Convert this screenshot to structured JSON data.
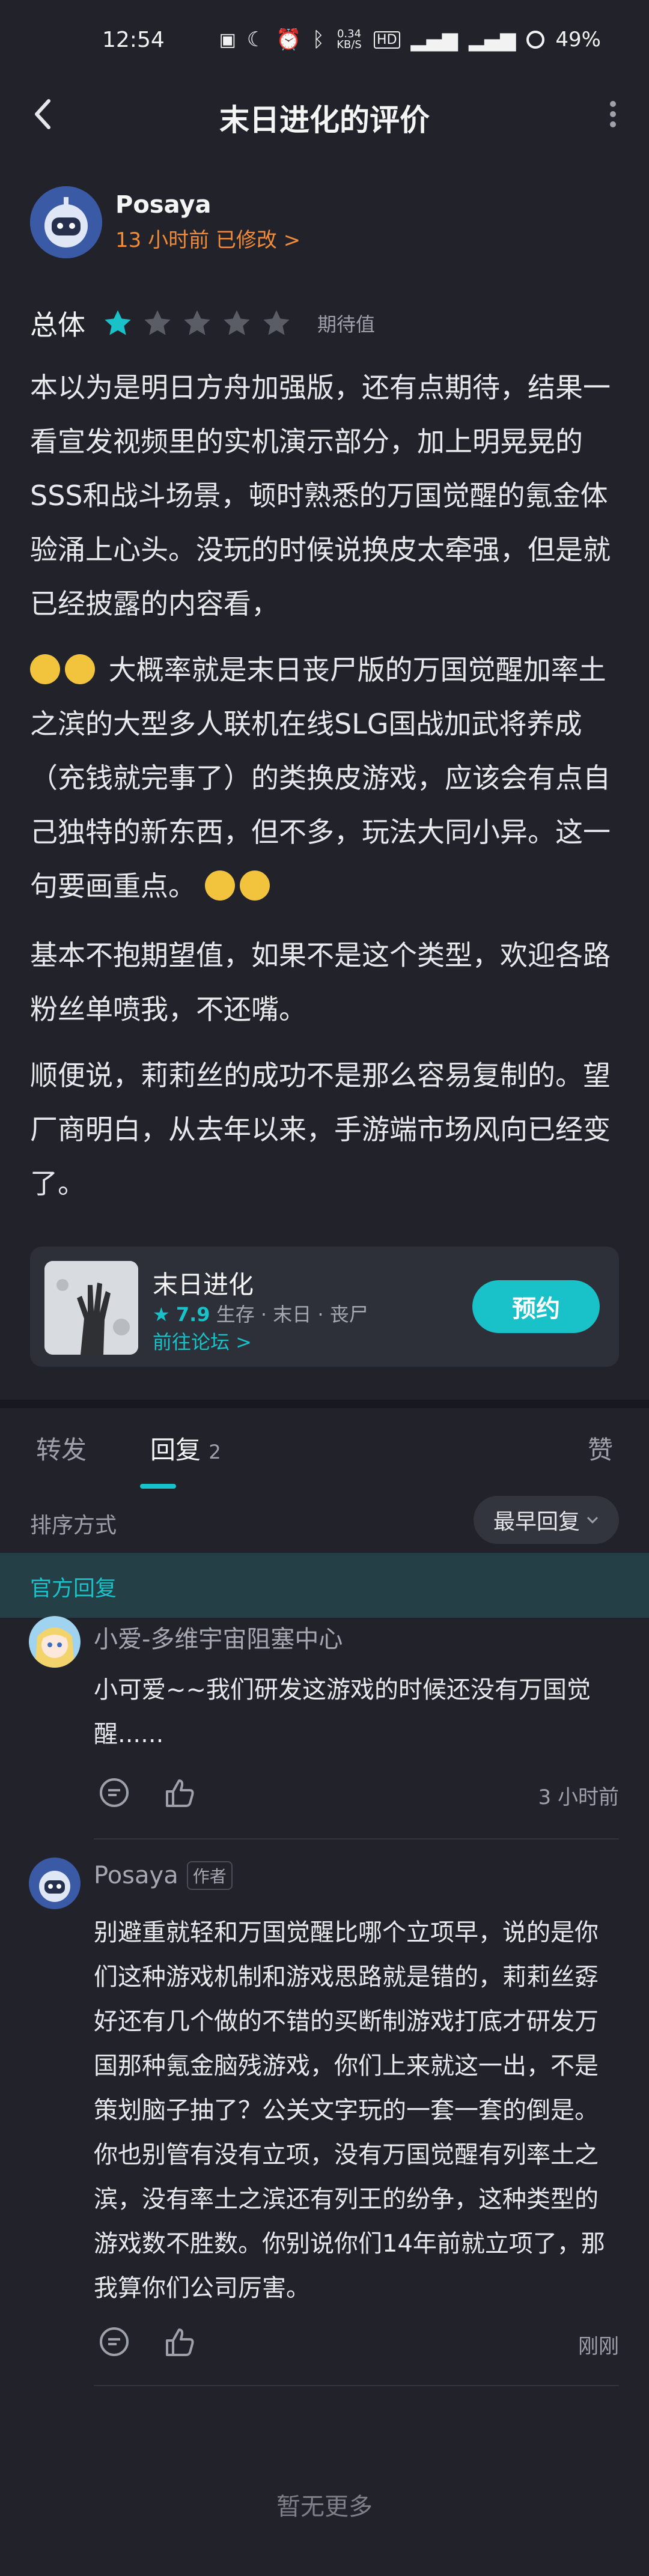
{
  "status_bar": {
    "time": "12:54",
    "net_speed": "0.34\nKB/S",
    "battery": "49%"
  },
  "header": {
    "title": "末日进化的评价",
    "back_icon": "back-arrow-icon",
    "more_icon": "more-vertical-icon"
  },
  "author": {
    "name": "Posaya",
    "meta": "13 小时前 已修改 >"
  },
  "rating": {
    "label": "总体",
    "stars": 1,
    "max": 5,
    "tag": "期待值"
  },
  "review": {
    "p1": "本以为是明日方舟加强版，还有点期待，结果一看宣发视频里的实机演示部分，加上明晃晃的SSS和战斗场景，顿时熟悉的万国觉醒的氪金体验涌上心头。没玩的时候说换皮太牵强，但是就已经披露的内容看，",
    "p2": "大概率就是末日丧尸版的万国觉醒加率土之滨的大型多人联机在线SLG国战加武将养成（充钱就完事了）的类换皮游戏，应该会有点自己独特的新东西，但不多，玩法大同小异。这一句要画重点。",
    "p3": "基本不抱期望值，如果不是这个类型，欢迎各路粉丝单喷我，不还嘴。",
    "p4": "顺便说，莉莉丝的成功不是那么容易复制的。望厂商明白，从去年以来，手游端市场风向已经变了。"
  },
  "game": {
    "name": "末日进化",
    "score": "7.9",
    "tags": "生存 · 末日 · 丧尸",
    "forum_link": "前往论坛 >",
    "reserve": "预约"
  },
  "tabs": {
    "forward": "转发",
    "reply": "回复",
    "reply_count": "2",
    "like": "赞"
  },
  "sort": {
    "label": "排序方式",
    "value": "最早回复"
  },
  "official": {
    "label": "官方回复"
  },
  "replies": [
    {
      "name": "小爱-多维宇宙阻塞中心",
      "text": "小可爱~~我们研发这游戏的时候还没有万国觉醒......",
      "time": "3 小时前"
    },
    {
      "name": "Posaya",
      "tag": "作者",
      "text": "别避重就轻和万国觉醒比哪个立项早，说的是你们这种游戏机制和游戏思路就是错的，莉莉丝孬好还有几个做的不错的买断制游戏打底才研发万国那种氪金脑残游戏，你们上来就这一出，不是策划脑子抽了？公关文字玩的一套一套的倒是。你也别管有没有立项，没有万国觉醒有列率土之滨，没有率土之滨还有列王的纷争，这种类型的游戏数不胜数。你别说你们14年前就立项了，那我算你们公司厉害。",
      "time": "刚刚"
    }
  ],
  "footer": {
    "no_more": "暂无更多"
  },
  "colors": {
    "background": "#21222a",
    "accent": "#19c2c9",
    "orange": "#f08b3a"
  }
}
